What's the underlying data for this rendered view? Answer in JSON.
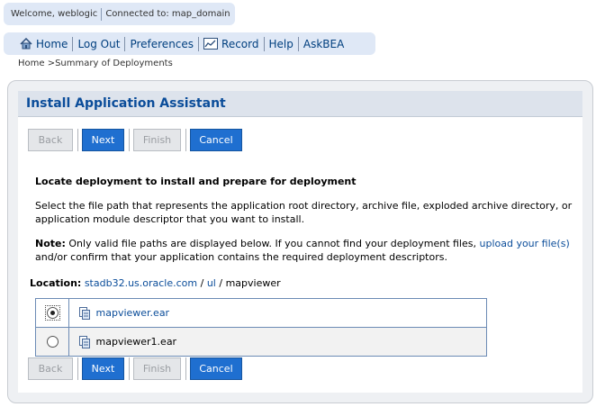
{
  "welcome": {
    "user_text": "Welcome, weblogic",
    "domain_text": "Connected to: map_domain"
  },
  "nav": {
    "items": [
      {
        "label": "Home",
        "icon": "home-icon"
      },
      {
        "label": "Log Out"
      },
      {
        "label": "Preferences"
      },
      {
        "label": "Record",
        "icon": "record-icon"
      },
      {
        "label": "Help"
      },
      {
        "label": "AskBEA"
      }
    ]
  },
  "breadcrumb": "Home >Summary of Deployments",
  "panel": {
    "title": "Install Application Assistant",
    "buttons": {
      "back": "Back",
      "next": "Next",
      "finish": "Finish",
      "cancel": "Cancel"
    },
    "heading": "Locate deployment to install and prepare for deployment",
    "description": "Select the file path that represents the application root directory, archive file, exploded archive directory, or application module descriptor that you want to install.",
    "note_label": "Note:",
    "note_text_1": " Only valid file paths are displayed below. If you cannot find your deployment files, ",
    "note_link": "upload your file(s)",
    "note_text_2": " and/or confirm that your application contains the required deployment descriptors.",
    "location_label": "Location:",
    "location_host": "stadb32.us.oracle.com",
    "location_sep1": " / ",
    "location_dir": "ul",
    "location_sep2": " / ",
    "location_current": "mapviewer",
    "files": [
      {
        "name": "mapviewer.ear",
        "selected": true,
        "is_link": true
      },
      {
        "name": "mapviewer1.ear",
        "selected": false,
        "is_link": false
      }
    ]
  },
  "colors": {
    "accent": "#1f6fd0",
    "title": "#0b4d9a",
    "nav_bg": "#dfe8f6"
  }
}
